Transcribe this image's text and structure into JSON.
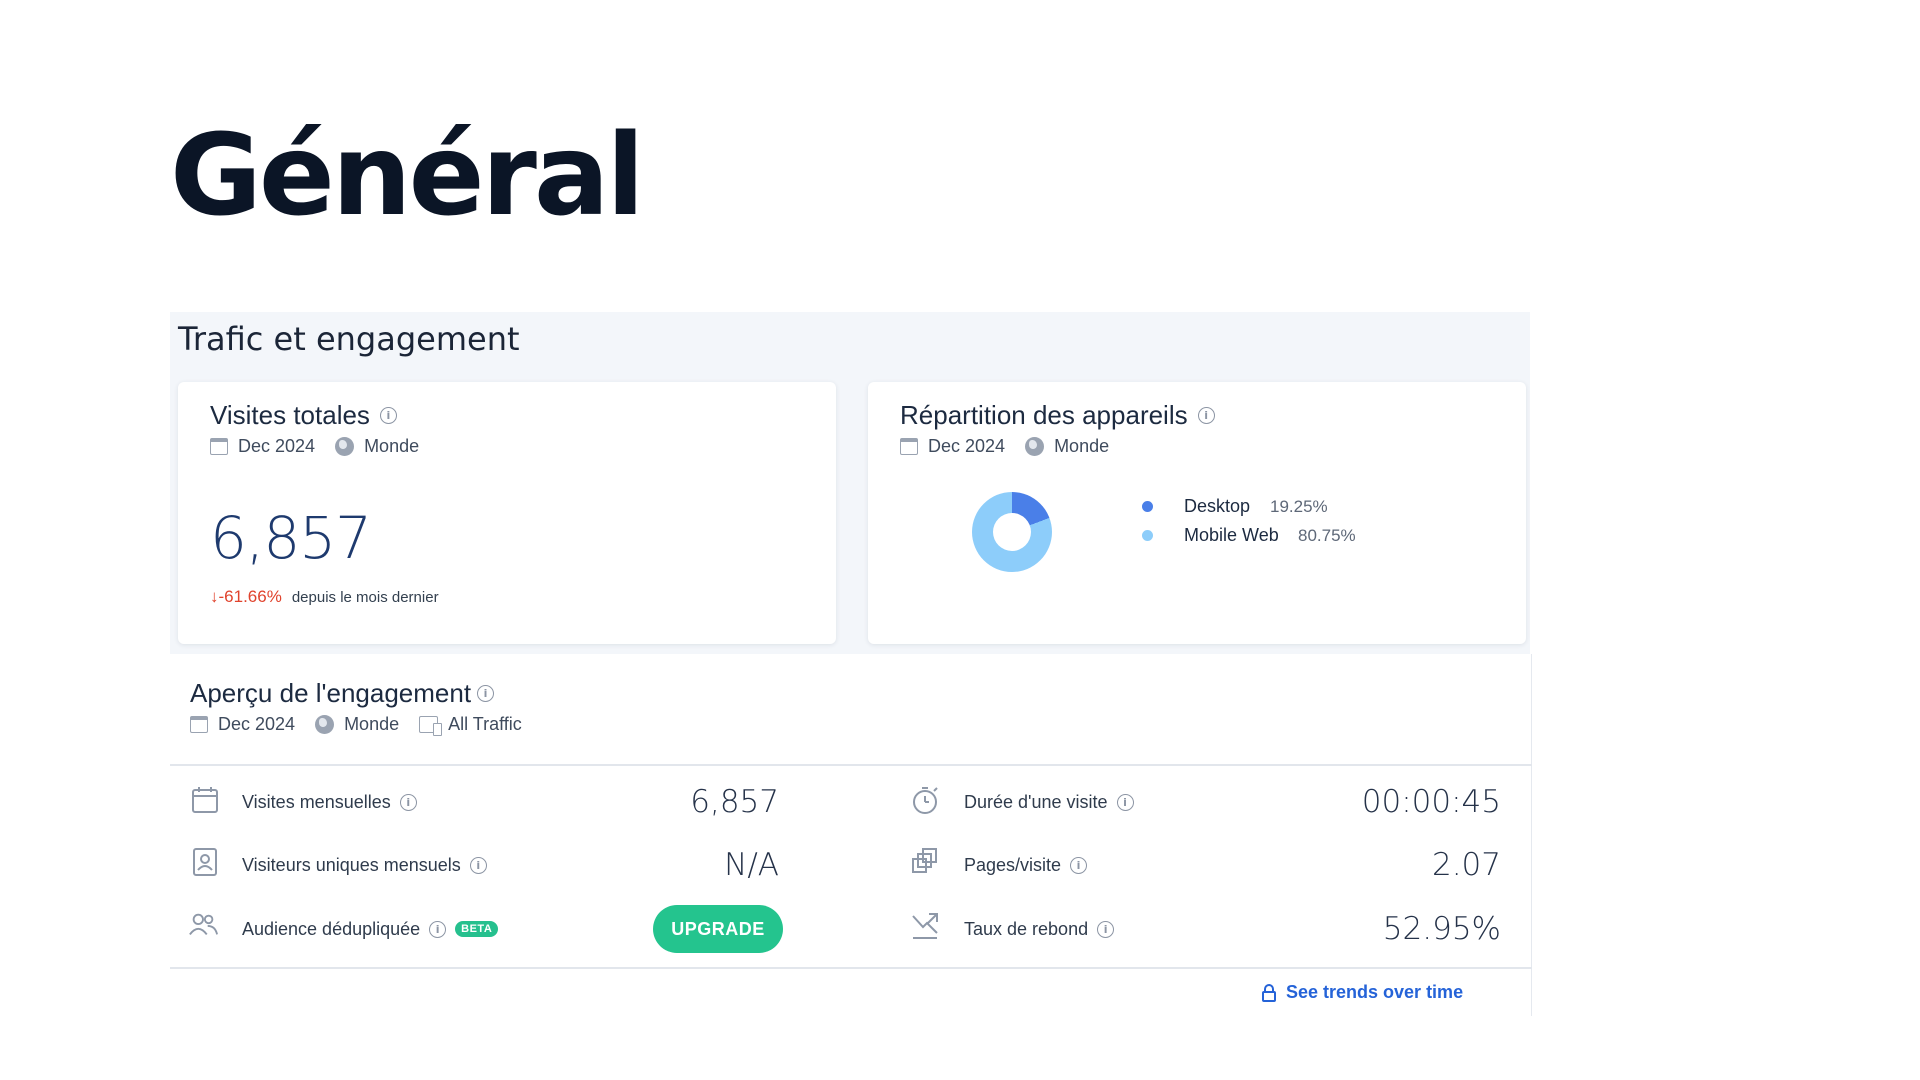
{
  "page": {
    "title": "Général"
  },
  "traffic_section": {
    "title": "Trafic et engagement",
    "visits_card": {
      "title": "Visites totales",
      "date": "Dec 2024",
      "region": "Monde",
      "value": "6,857",
      "change": "-61.66%",
      "change_label": "depuis le mois dernier",
      "change_color": "#e0432d"
    },
    "devices_card": {
      "title": "Répartition des appareils",
      "date": "Dec 2024",
      "region": "Monde",
      "devices": [
        {
          "name": "Desktop",
          "pct_label": "19.25%",
          "share": 19.25,
          "color": "#4a7fe8"
        },
        {
          "name": "Mobile Web",
          "pct_label": "80.75%",
          "share": 80.75,
          "color": "#8dcdfa"
        }
      ]
    }
  },
  "engagement": {
    "title": "Aperçu de l'engagement",
    "date": "Dec 2024",
    "region": "Monde",
    "traffic": "All Traffic",
    "metrics_left": [
      {
        "label": "Visites mensuelles",
        "value": "6,857",
        "icon": "calendar-icon"
      },
      {
        "label": "Visiteurs uniques mensuels",
        "value": "N/A",
        "icon": "id-card-icon"
      },
      {
        "label": "Audience dédupliquée",
        "badge": "BETA",
        "action": "UPGRADE",
        "icon": "people-icon"
      }
    ],
    "metrics_right": [
      {
        "label": "Durée d'une visite",
        "value": "00:00:45",
        "icon": "stopwatch-icon"
      },
      {
        "label": "Pages/visite",
        "value": "2.07",
        "icon": "pages-icon"
      },
      {
        "label": "Taux de rebond",
        "value": "52.95%",
        "icon": "bounce-icon"
      }
    ],
    "trends_link": "See trends over time"
  },
  "colors": {
    "accent_green": "#24c48e",
    "link_blue": "#2563d8",
    "primary_number": "#1e3a6e"
  }
}
